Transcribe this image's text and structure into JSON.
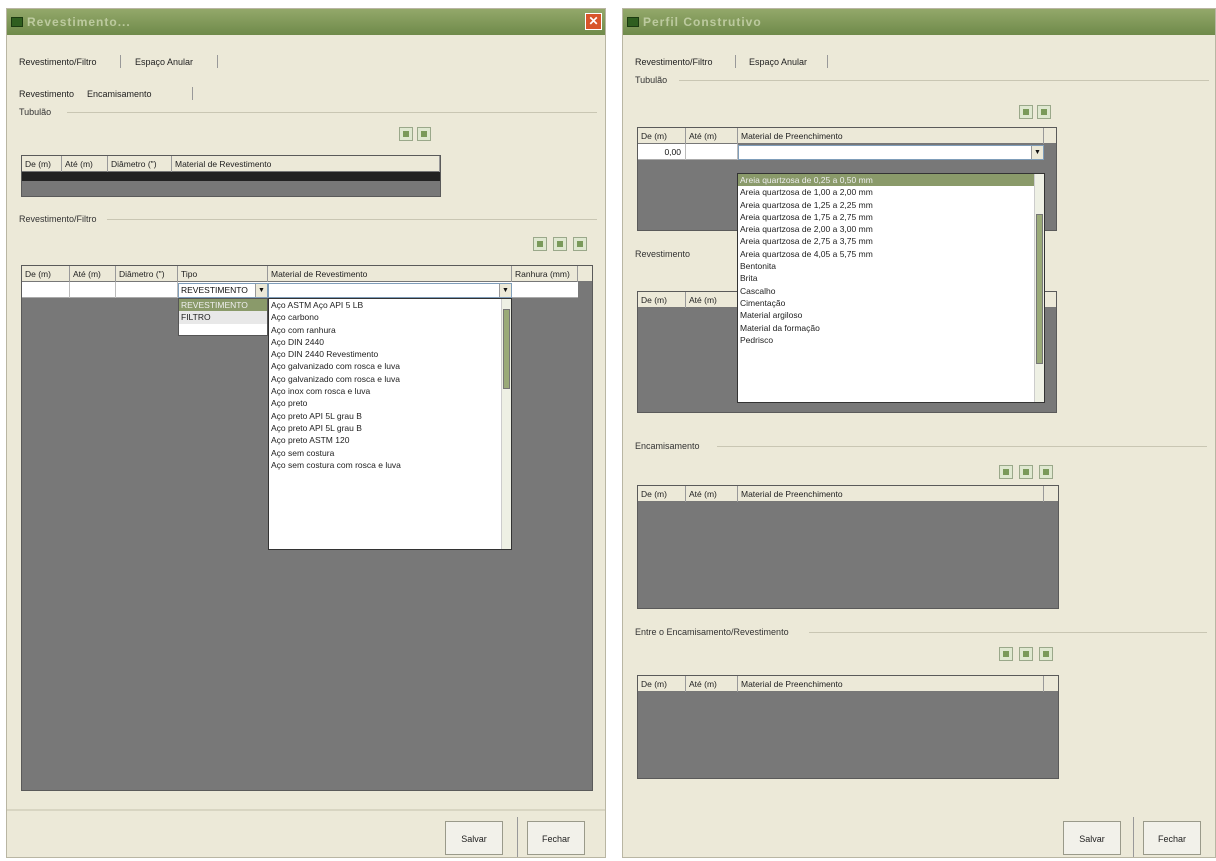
{
  "colors": {
    "titlebar": "#7e9658",
    "grid_bg": "#787878",
    "dialog_bg": "#ece9d8",
    "selected": "#8a9a6a",
    "close": "#d8552a"
  },
  "left": {
    "title": "Revestimento...",
    "tabs": [
      "Revestimento/Filtro",
      "Espaço Anular"
    ],
    "subtabs": [
      "Revestimento",
      "Encamisamento"
    ],
    "sec_top": "Tubulão",
    "top_grid_headers": [
      "De (m)",
      "Até (m)",
      "Diâmetro (\")",
      "Material de Revestimento"
    ],
    "sec_rev": "Revestimento/Filtro",
    "rev_headers": [
      "De (m)",
      "Até (m)",
      "Diâmetro (\")",
      "Tipo",
      "Material de Revestimento",
      "Ranhura (mm)"
    ],
    "tipo_value": "REVESTIMENTO",
    "tipo_options": [
      "REVESTIMENTO",
      "FILTRO"
    ],
    "material_options": [
      "Aço ASTM Aço API 5 LB",
      "Aço carbono",
      "Aço com ranhura",
      "Aço DIN 2440",
      "Aço DIN 2440 Revestimento",
      "Aço galvanizado com rosca e luva",
      "Aço galvanizado com rosca e luva",
      "Aço inox com rosca e luva",
      "Aço preto",
      "Aço preto API 5L grau B",
      "Aço preto API 5L grau B",
      "Aço preto ASTM 120",
      "Aço sem costura",
      "Aço sem costura com rosca e luva"
    ],
    "btn_save": "Salvar",
    "btn_close": "Fechar"
  },
  "right": {
    "title": "Perfil Construtivo",
    "tabs": [
      "Revestimento/Filtro",
      "Espaço Anular"
    ],
    "sec_top": "Tubulão",
    "top_headers": [
      "De (m)",
      "Até (m)",
      "Material de Preenchimento"
    ],
    "top_row": [
      "0,00",
      "",
      ""
    ],
    "fill_options": [
      "Areia quartzosa de 0,25 a 0,50 mm",
      "Areia quartzosa de 1,00 a 2,00 mm",
      "Areia quartzosa de 1,25 a 2,25 mm",
      "Areia quartzosa de 1,75 a 2,75 mm",
      "Areia quartzosa de 2,00 a 3,00 mm",
      "Areia quartzosa de 2,75 a 3,75 mm",
      "Areia quartzosa de 4,05 a 5,75 mm",
      "Bentonita",
      "Brita",
      "Cascalho",
      "Cimentação",
      "Material argiloso",
      "Material da formação",
      "Pedrisco"
    ],
    "sec_rev": "Revestimento",
    "rev_headers": [
      "De (m)",
      "Até (m)"
    ],
    "sec_enc": "Encamisamento",
    "enc_headers": [
      "De (m)",
      "Até (m)",
      "Material de Preenchimento"
    ],
    "sec_ent": "Entre o Encamisamento/Revestimento",
    "ent_headers": [
      "De (m)",
      "Até (m)",
      "Material de Preenchimento"
    ],
    "btn_save": "Salvar",
    "btn_close": "Fechar"
  }
}
